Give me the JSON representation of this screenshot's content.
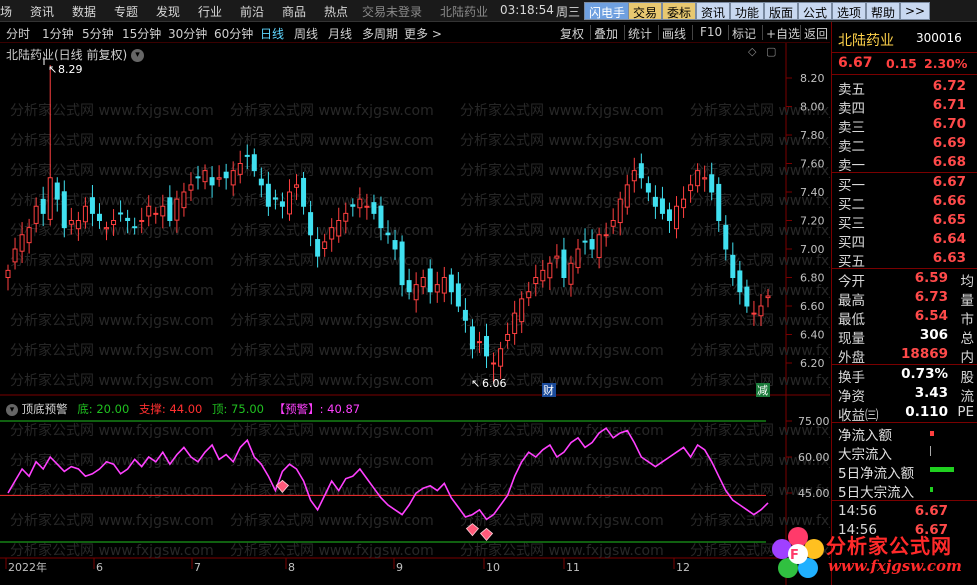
{
  "menu": {
    "items": [
      "场",
      "资讯",
      "数据",
      "专题",
      "发现",
      "行业",
      "前沿",
      "商品",
      "热点"
    ],
    "trade_status": "交易未登录",
    "stock_name": "北陆药业",
    "clock": "03:18:54",
    "weekday": "周三",
    "buttons": [
      "闪电手",
      "交易",
      "委标",
      "资讯",
      "功能",
      "版面",
      "公式",
      "选项",
      "帮助",
      ">>"
    ]
  },
  "tabs": {
    "periods": [
      "分时",
      "1分钟",
      "5分钟",
      "15分钟",
      "30分钟",
      "60分钟",
      "日线",
      "周线",
      "月线",
      "多周期",
      "更多 >"
    ],
    "active": "日线",
    "right": [
      "复权",
      "叠加",
      "统计",
      "画线",
      "F10",
      "标记",
      "+自选",
      "返回"
    ]
  },
  "chart": {
    "title": "北陆药业(日线 前复权)",
    "high_label": "8.29",
    "low_label": "6.06",
    "badge_cai": "财",
    "badge_jian": "减",
    "y_ticks": [
      "8.20",
      "8.00",
      "7.80",
      "7.60",
      "7.40",
      "7.20",
      "7.00",
      "6.80",
      "6.60",
      "6.40",
      "6.20"
    ],
    "indicator": {
      "name": "顶底预警",
      "bottom_label": "底: 20.00",
      "support_label": "支撑: 44.00",
      "top_label": "顶: 75.00",
      "alert_label": "【预警】: 40.87",
      "y_ticks": [
        "75.00",
        "60.00",
        "45.00"
      ]
    },
    "x_labels": [
      "2022年",
      "6",
      "7",
      "8",
      "9",
      "10",
      "11",
      "12"
    ],
    "watermark": "分析家公式网 www.fxjgsw.com",
    "colors": {
      "up": "#ff4040",
      "down": "#40e0f0",
      "line": "#ff40ff",
      "support": "#ff3030",
      "levels": "#20c020"
    }
  },
  "chart_data": [
    {
      "type": "candlestick",
      "title": "北陆药业(日线 前复权)",
      "ylim": [
        6.06,
        8.29
      ],
      "x_labels": [
        "2022年",
        "6",
        "7",
        "8",
        "9",
        "10",
        "11",
        "12"
      ],
      "annotations": [
        {
          "label": "8.29",
          "value": 8.29
        },
        {
          "label": "6.06",
          "value": 6.06
        }
      ],
      "close_approx": [
        6.85,
        7.0,
        7.1,
        7.15,
        7.3,
        7.25,
        7.5,
        7.35,
        7.15,
        7.2,
        7.2,
        7.3,
        7.25,
        7.2,
        7.15,
        7.2,
        7.25,
        7.2,
        7.15,
        7.2,
        7.3,
        7.25,
        7.3,
        7.2,
        7.35,
        7.4,
        7.45,
        7.5,
        7.55,
        7.45,
        7.5,
        7.5,
        7.55,
        7.6,
        7.65,
        7.55,
        7.45,
        7.3,
        7.35,
        7.3,
        7.4,
        7.45,
        7.3,
        7.1,
        6.95,
        7.05,
        7.15,
        7.2,
        7.25,
        7.3,
        7.35,
        7.3,
        7.25,
        7.15,
        7.1,
        7.0,
        6.75,
        6.7,
        6.75,
        6.8,
        6.7,
        6.75,
        6.8,
        6.7,
        6.6,
        6.5,
        6.3,
        6.35,
        6.25,
        6.2,
        6.3,
        6.4,
        6.55,
        6.65,
        6.7,
        6.8,
        6.85,
        6.9,
        6.95,
        6.8,
        6.9,
        7.0,
        7.05,
        7.0,
        7.1,
        7.1,
        7.2,
        7.35,
        7.45,
        7.55,
        7.5,
        7.4,
        7.3,
        7.25,
        7.2,
        7.3,
        7.35,
        7.45,
        7.55,
        7.5,
        7.4,
        7.2,
        7.0,
        6.8,
        6.7,
        6.6,
        6.55,
        6.6,
        6.67
      ]
    },
    {
      "type": "line",
      "title": "顶底预警",
      "ylim": [
        15,
        80
      ],
      "levels": [
        {
          "label": "底",
          "value": 20.0
        },
        {
          "label": "支撑",
          "value": 44.0
        },
        {
          "label": "顶",
          "value": 75.0
        }
      ],
      "series": [
        {
          "name": "预警",
          "values": [
            45,
            50,
            55,
            52,
            58,
            55,
            60,
            57,
            54,
            56,
            55,
            52,
            53,
            55,
            58,
            57,
            53,
            55,
            59,
            56,
            60,
            58,
            62,
            57,
            61,
            64,
            60,
            58,
            62,
            65,
            59,
            61,
            58,
            64,
            67,
            60,
            57,
            52,
            46,
            54,
            57,
            55,
            50,
            42,
            38,
            44,
            50,
            46,
            51,
            52,
            55,
            51,
            47,
            43,
            40,
            38,
            36,
            40,
            45,
            47,
            48,
            46,
            49,
            43,
            39,
            35,
            36,
            38,
            34,
            36,
            40,
            44,
            52,
            58,
            62,
            60,
            63,
            65,
            60,
            62,
            66,
            68,
            64,
            66,
            70,
            72,
            68,
            70,
            71,
            66,
            60,
            58,
            56,
            58,
            60,
            62,
            64,
            60,
            65,
            63,
            58,
            52,
            46,
            42,
            40,
            38,
            36,
            38,
            40.87
          ]
        }
      ]
    }
  ],
  "panel": {
    "name": "北陆药业",
    "code": "300016",
    "price": "6.67",
    "change": "0.15",
    "pct": "2.30%",
    "asks": [
      {
        "label": "卖五",
        "price": "6.72"
      },
      {
        "label": "卖四",
        "price": "6.71"
      },
      {
        "label": "卖三",
        "price": "6.70"
      },
      {
        "label": "卖二",
        "price": "6.69"
      },
      {
        "label": "卖一",
        "price": "6.68"
      }
    ],
    "bids": [
      {
        "label": "买一",
        "price": "6.67"
      },
      {
        "label": "买二",
        "price": "6.66"
      },
      {
        "label": "买三",
        "price": "6.65"
      },
      {
        "label": "买四",
        "price": "6.64"
      },
      {
        "label": "买五",
        "price": "6.63"
      }
    ],
    "stats": [
      {
        "label": "今开",
        "value": "6.59",
        "suffix": "均"
      },
      {
        "label": "最高",
        "value": "6.73",
        "suffix": "量"
      },
      {
        "label": "最低",
        "value": "6.54",
        "suffix": "市"
      },
      {
        "label": "现量",
        "value": "306",
        "suffix": "总"
      },
      {
        "label": "外盘",
        "value": "18869",
        "suffix": "内"
      }
    ],
    "stats2": [
      {
        "label": "换手",
        "value": "0.73%",
        "suffix": "股"
      },
      {
        "label": "净资",
        "value": "3.43",
        "suffix": "流"
      },
      {
        "label": "收益㈢",
        "value": "0.110",
        "suffix": "PE"
      }
    ],
    "flows": [
      "净流入额",
      "大宗流入",
      "5日净流入额",
      "5日大宗流入"
    ],
    "ticks": [
      {
        "time": "14:56",
        "price": "6.67"
      },
      {
        "time": "14:56",
        "price": "6.67"
      }
    ]
  },
  "logo": {
    "cn": "分析家公式网",
    "url": "www.fxjgsw.com"
  }
}
